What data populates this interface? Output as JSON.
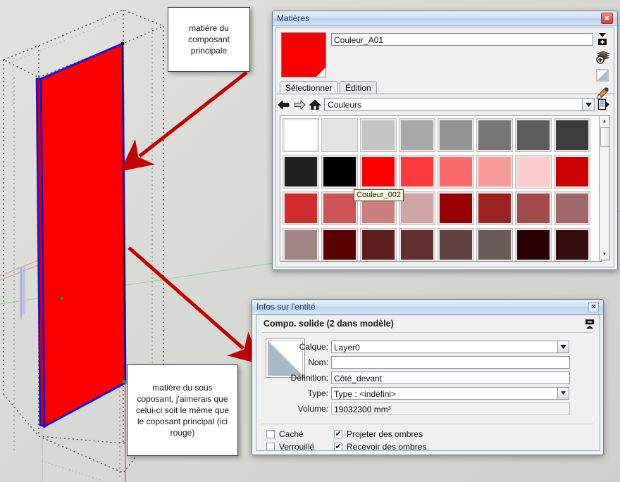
{
  "app": {
    "viewport_name": "sketchup-3d-viewport"
  },
  "callouts": [
    {
      "id": "callout-main-component-material",
      "text": "matière du composant principale"
    },
    {
      "id": "callout-subcomponent-material",
      "text": "matière du sous coposant, j'aimerais que celui-ci soit le même que le coposant principal (ici rouge)"
    }
  ],
  "materials_panel": {
    "title": "Matières",
    "close_label": "✖",
    "current_material_name": "Couleur_A01",
    "current_material_color": "#fc0000",
    "right_icons": [
      {
        "name": "create-material-icon",
        "title": "Créer une matière"
      },
      {
        "name": "material-stack-add-icon",
        "title": "Ajouter"
      },
      {
        "name": "default-material-icon",
        "title": "Matière par défaut"
      },
      {
        "name": "eyedropper-icon",
        "title": "Pipette"
      }
    ],
    "tabs": [
      {
        "label": "Sélectionner",
        "selected": true
      },
      {
        "label": "Édition",
        "selected": false
      }
    ],
    "nav": {
      "back_icon": "arrow-left-icon",
      "forward_icon": "arrow-right-icon",
      "home_icon": "home-icon",
      "library": "Couleurs",
      "details_icon": "details-panel-icon"
    },
    "tooltip": "Couleur_002",
    "swatches": [
      "#ffffff",
      "#e3e3e3",
      "#c4c4c4",
      "#a9a9a9",
      "#949494",
      "#777777",
      "#5d5d5d",
      "#3c3c3c",
      "#1f1f1f",
      "#000000",
      "#ff0000",
      "#fb3b3b",
      "#fb6b6b",
      "#f99b9b",
      "#fbcccc",
      "#cc0000",
      "#d22b2b",
      "#cd5555",
      "#cc7f7f",
      "#cfa5a5",
      "#990000",
      "#9c2222",
      "#a34b4b",
      "#a06868",
      "#a28686",
      "#5b0000",
      "#5e1f1f",
      "#63302f",
      "#5f423f",
      "#6b5a57",
      "#2a0404",
      "#330d0d"
    ],
    "scrollbar": {
      "up_arrow": "▲",
      "down_arrow": "▼"
    }
  },
  "entity_info": {
    "title": "Infos sur l'entité",
    "close_label": "⊠",
    "heading": "Compo. solide (2 dans modèle)",
    "thumbnail_name": "default-material-thumbnail",
    "fields": [
      {
        "label": "Calque:",
        "value": "Layer0",
        "type": "select",
        "name": "layer-field"
      },
      {
        "label": "Nom:",
        "value": "",
        "type": "text",
        "name": "name-field"
      },
      {
        "label": "Définition:",
        "value": "Côté_devant",
        "type": "text",
        "name": "definition-field"
      },
      {
        "label": "Type:",
        "value": "Type : <indéfini>",
        "type": "select",
        "name": "type-field"
      },
      {
        "label": "Volume:",
        "value": "19032300 mm³",
        "type": "readonly",
        "name": "volume-field"
      }
    ],
    "checkboxes": [
      {
        "label": "Caché",
        "checked": false,
        "name": "hidden-checkbox"
      },
      {
        "label": "Verrouillé",
        "checked": false,
        "name": "locked-checkbox"
      },
      {
        "label": "Projeter des ombres",
        "checked": true,
        "name": "cast-shadows-checkbox"
      },
      {
        "label": "Recevoir des ombres",
        "checked": true,
        "name": "receive-shadows-checkbox"
      }
    ]
  },
  "annotations": {
    "arrow_color": "#c00000",
    "highlight_circle_color": "#e00000",
    "selection_color": "#0000ff",
    "face_color": "#fc0000"
  }
}
